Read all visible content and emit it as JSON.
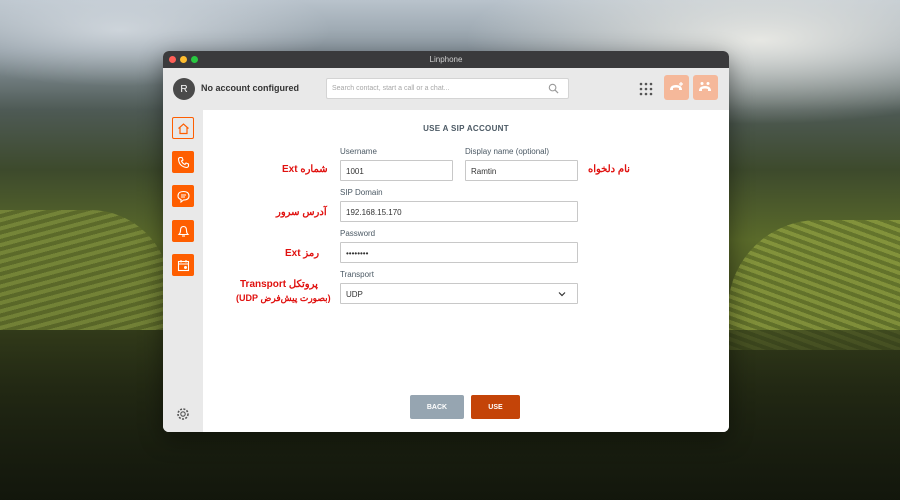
{
  "window": {
    "title": "Linphone"
  },
  "topbar": {
    "avatar_letter": "R",
    "account_status": "No account configured",
    "search_placeholder": "Search contact, start a call or a chat..."
  },
  "form": {
    "heading": "USE A SIP ACCOUNT",
    "username_label": "Username",
    "username_value": "1001",
    "display_label": "Display name (optional)",
    "display_value": "Ramtin",
    "domain_label": "SIP Domain",
    "domain_value": "192.168.15.170",
    "password_label": "Password",
    "password_value": "••••••••",
    "transport_label": "Transport",
    "transport_value": "UDP",
    "back_label": "BACK",
    "use_label": "USE"
  },
  "annotations": {
    "username": "شماره Ext",
    "display": "نام دلخواه",
    "domain": "آدرس سرور",
    "password": "رمز Ext",
    "transport_1": "پروتکل Transport",
    "transport_2": "(بصورت پیش‌فرض UDP)"
  },
  "colors": {
    "accent": "#fe5e00",
    "use_button": "#c44408",
    "back_button": "#96a5b1",
    "annotation": "#e0110f"
  },
  "icons": [
    "search-icon",
    "dialpad-icon",
    "home-icon",
    "phone-icon",
    "chat-icon",
    "contact-icon",
    "calendar-icon",
    "gear-icon",
    "chevron-down-icon"
  ]
}
